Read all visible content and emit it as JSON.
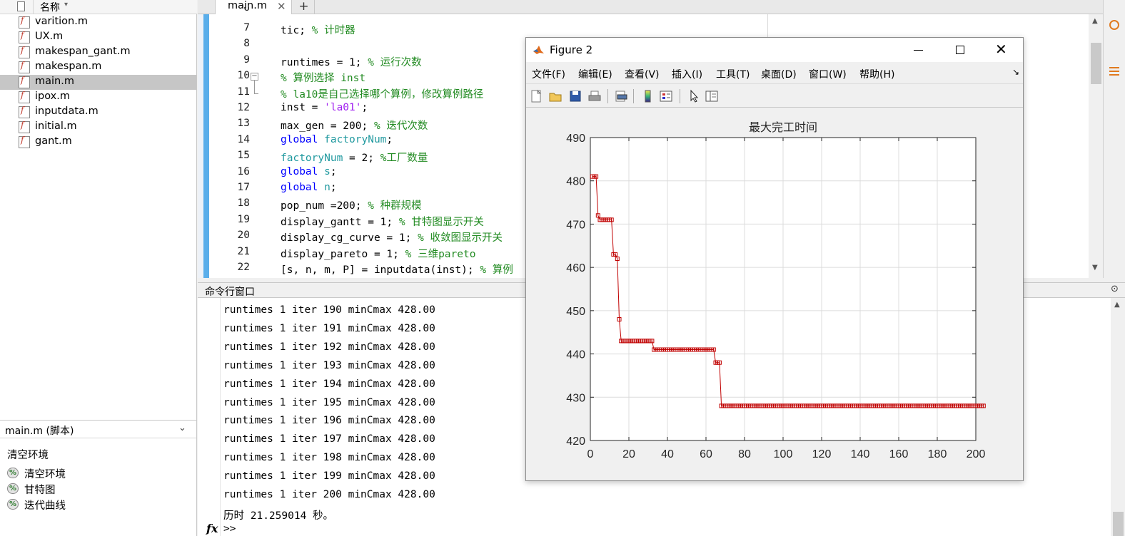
{
  "file_browser": {
    "header_label": "名称",
    "files": [
      {
        "name": "varition.m",
        "selected": false
      },
      {
        "name": "UX.m",
        "selected": false
      },
      {
        "name": "makespan_gant.m",
        "selected": false
      },
      {
        "name": "makespan.m",
        "selected": false
      },
      {
        "name": "main.m",
        "selected": true
      },
      {
        "name": "ipox.m",
        "selected": false
      },
      {
        "name": "inputdata.m",
        "selected": false
      },
      {
        "name": "initial.m",
        "selected": false
      },
      {
        "name": "gant.m",
        "selected": false
      }
    ],
    "details_label": "main.m  (脚本)",
    "outline_title": "清空环境",
    "outline_items": [
      "清空环境",
      "甘特图",
      "迭代曲线"
    ]
  },
  "editor": {
    "tab_label": "main.m",
    "tab_close": "✕",
    "tab_add": "+",
    "top_partial_line": "6",
    "lines": [
      {
        "n": "7",
        "segs": [
          [
            "",
            "tic; "
          ],
          [
            "cm",
            "% 计时器"
          ]
        ]
      },
      {
        "n": "8",
        "segs": []
      },
      {
        "n": "9",
        "segs": [
          [
            "",
            "runtimes = 1; "
          ],
          [
            "cm",
            "% 运行次数"
          ]
        ]
      },
      {
        "n": "10",
        "segs": [
          [
            "cm",
            "% 算例选择 inst"
          ]
        ]
      },
      {
        "n": "11",
        "segs": [
          [
            "cm",
            "% la10是自己选择哪个算例，修改算例路径"
          ]
        ]
      },
      {
        "n": "12",
        "segs": [
          [
            "",
            "inst = "
          ],
          [
            "st",
            "'la01'"
          ],
          [
            "",
            ";"
          ]
        ]
      },
      {
        "n": "13",
        "segs": [
          [
            "",
            "max_gen = 200; "
          ],
          [
            "cm",
            "% 迭代次数"
          ]
        ]
      },
      {
        "n": "14",
        "segs": [
          [
            "kw",
            "global "
          ],
          [
            "gv",
            "factoryNum"
          ],
          [
            "",
            ";"
          ]
        ]
      },
      {
        "n": "15",
        "segs": [
          [
            "gv",
            "factoryNum"
          ],
          [
            "",
            " = 2; "
          ],
          [
            "cm",
            "%工厂数量"
          ]
        ]
      },
      {
        "n": "16",
        "segs": [
          [
            "kw",
            "global "
          ],
          [
            "gv",
            "s"
          ],
          [
            "",
            ";"
          ]
        ]
      },
      {
        "n": "17",
        "segs": [
          [
            "kw",
            "global "
          ],
          [
            "gv",
            "n"
          ],
          [
            "",
            ";"
          ]
        ]
      },
      {
        "n": "18",
        "segs": [
          [
            "",
            "pop_num =200; "
          ],
          [
            "cm",
            "% 种群规模"
          ]
        ]
      },
      {
        "n": "19",
        "segs": [
          [
            "",
            "display_gantt = 1; "
          ],
          [
            "cm",
            "% 甘特图显示开关"
          ]
        ]
      },
      {
        "n": "20",
        "segs": [
          [
            "",
            "display_cg_curve = 1; "
          ],
          [
            "cm",
            "% 收敛图显示开关"
          ]
        ]
      },
      {
        "n": "21",
        "segs": [
          [
            "",
            "display_pareto = 1; "
          ],
          [
            "cm",
            "% 三维pareto"
          ]
        ]
      },
      {
        "n": "22",
        "segs": [
          [
            "",
            "[s, n, m, P] = inputdata(inst); "
          ],
          [
            "cm",
            "% 算例"
          ]
        ]
      }
    ]
  },
  "command_window": {
    "title": "命令行窗口",
    "output_lines": [
      "runtimes 1 iter 190 minCmax 428.00",
      "runtimes 1 iter 191 minCmax 428.00",
      "runtimes 1 iter 192 minCmax 428.00",
      "runtimes 1 iter 193 minCmax 428.00",
      "runtimes 1 iter 194 minCmax 428.00",
      "runtimes 1 iter 195 minCmax 428.00",
      "runtimes 1 iter 196 minCmax 428.00",
      "runtimes 1 iter 197 minCmax 428.00",
      "runtimes 1 iter 198 minCmax 428.00",
      "runtimes 1 iter 199 minCmax 428.00",
      "runtimes 1 iter 200 minCmax 428.00",
      "历时 21.259014 秒。"
    ],
    "prompt_fx": "fx",
    "prompt_arrow": ">>"
  },
  "figure": {
    "title": "Figure 2",
    "menus": [
      "文件(F)",
      "编辑(E)",
      "查看(V)",
      "插入(I)",
      "工具(T)",
      "桌面(D)",
      "窗口(W)",
      "帮助(H)"
    ],
    "toolbar_icons": [
      "new-figure-icon",
      "open-file-icon",
      "save-icon",
      "print-icon",
      "print-preview-icon",
      "colorbar-icon",
      "legend-icon",
      "pointer-icon",
      "property-editor-icon"
    ]
  },
  "chart_data": {
    "type": "line",
    "title": "最大完工时间",
    "xlabel": "",
    "ylabel": "",
    "xlim": [
      0,
      200
    ],
    "ylim": [
      420,
      490
    ],
    "xticks": [
      0,
      20,
      40,
      60,
      80,
      100,
      120,
      140,
      160,
      180,
      200
    ],
    "yticks": [
      420,
      430,
      440,
      450,
      460,
      470,
      480,
      490
    ],
    "grid": true,
    "marker": "square",
    "color": "#c00000",
    "x_start": 1,
    "values": [
      481,
      481,
      481,
      472,
      471,
      471,
      471,
      471,
      471,
      471,
      471,
      463,
      463,
      462,
      448,
      443,
      443,
      443,
      443,
      443,
      443,
      443,
      443,
      443,
      443,
      443,
      443,
      443,
      443,
      443,
      443,
      443,
      441,
      441,
      441,
      441,
      441,
      441,
      441,
      441,
      441,
      441,
      441,
      441,
      441,
      441,
      441,
      441,
      441,
      441,
      441,
      441,
      441,
      441,
      441,
      441,
      441,
      441,
      441,
      441,
      441,
      441,
      441,
      441,
      438,
      438,
      438,
      428,
      428,
      428,
      428,
      428,
      428,
      428,
      428,
      428,
      428,
      428,
      428,
      428,
      428,
      428,
      428,
      428,
      428,
      428,
      428,
      428,
      428,
      428,
      428,
      428,
      428,
      428,
      428,
      428,
      428,
      428,
      428,
      428,
      428,
      428,
      428,
      428,
      428,
      428,
      428,
      428,
      428,
      428,
      428,
      428,
      428,
      428,
      428,
      428,
      428,
      428,
      428,
      428,
      428,
      428,
      428,
      428,
      428,
      428,
      428,
      428,
      428,
      428,
      428,
      428,
      428,
      428,
      428,
      428,
      428,
      428,
      428,
      428,
      428,
      428,
      428,
      428,
      428,
      428,
      428,
      428,
      428,
      428,
      428,
      428,
      428,
      428,
      428,
      428,
      428,
      428,
      428,
      428,
      428,
      428,
      428,
      428,
      428,
      428,
      428,
      428,
      428,
      428,
      428,
      428,
      428,
      428,
      428,
      428,
      428,
      428,
      428,
      428,
      428,
      428,
      428,
      428,
      428,
      428,
      428,
      428,
      428,
      428,
      428,
      428,
      428,
      428,
      428,
      428,
      428,
      428,
      428,
      428,
      428,
      428,
      428,
      428
    ]
  }
}
